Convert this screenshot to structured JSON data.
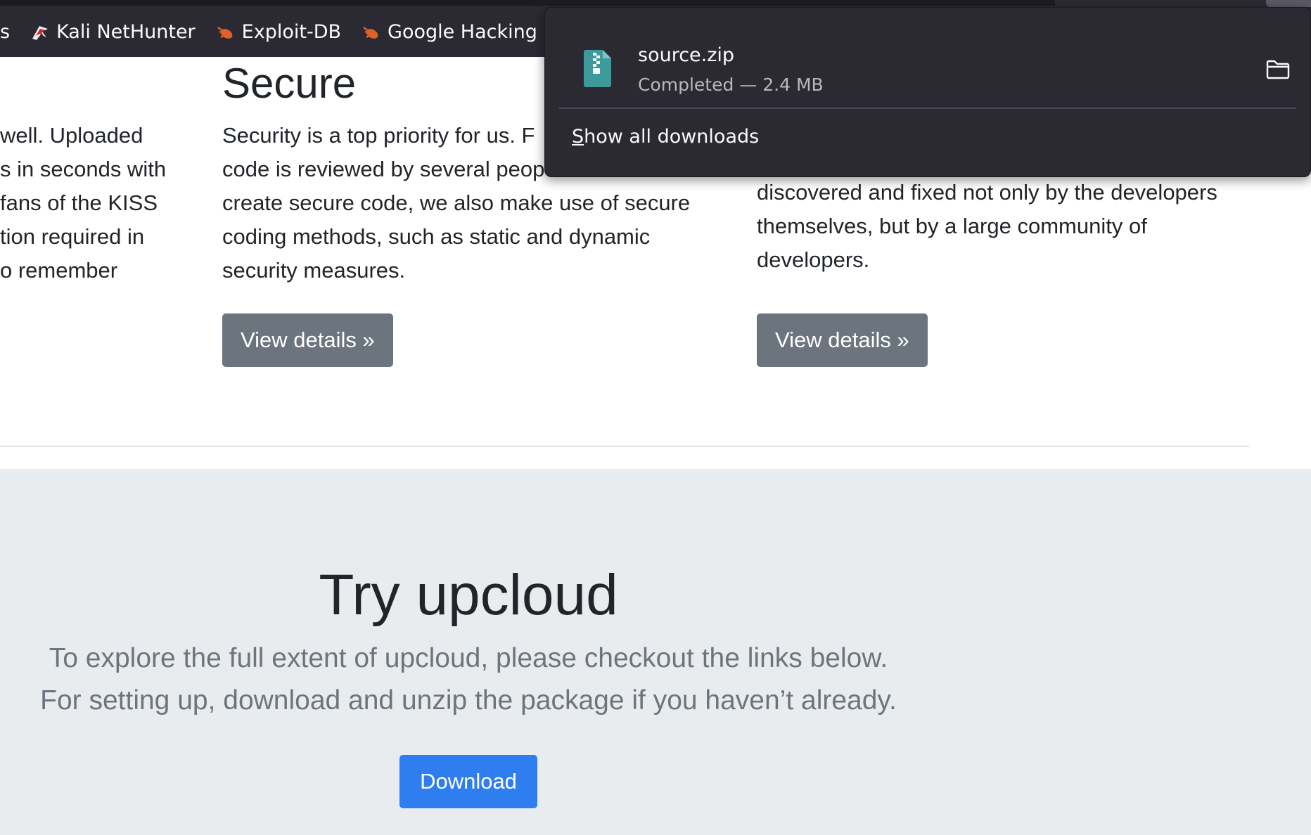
{
  "bookmarks": [
    {
      "label": "s",
      "icon": "none"
    },
    {
      "label": "Kali NetHunter",
      "icon": "kali-dragon-icon"
    },
    {
      "label": "Exploit-DB",
      "icon": "exploit-db-bug-icon"
    },
    {
      "label": "Google Hacking D",
      "icon": "exploit-db-bug-icon"
    }
  ],
  "columns": {
    "left": {
      "lines": [
        "well. Uploaded",
        "s in seconds with",
        "fans of the KISS",
        "tion required in",
        "o remember"
      ]
    },
    "middle": {
      "heading": "Secure",
      "lines": [
        "Security is a top priority for us. F",
        "code is reviewed by several peop",
        "create secure code, we also make use of secure",
        "coding methods, such as static and dynamic",
        "security measures."
      ],
      "button": "View details »"
    },
    "right": {
      "lines": [
        "discovered and fixed not only by the developers",
        "themselves, but by a large community of",
        "developers."
      ],
      "button": "View details »"
    }
  },
  "jumbotron": {
    "title": "Try upcloud",
    "lead_line1": "To explore the full extent of upcloud, please checkout the links below.",
    "lead_line2": "For setting up, download and unzip the package if you haven’t already.",
    "button": "Download"
  },
  "downloads_panel": {
    "filename": "source.zip",
    "status": "Completed — 2.4 MB",
    "show_all_access_key": "S",
    "show_all_rest": "how all downloads",
    "file_icon": "zip-file-icon",
    "folder_icon": "folder-icon"
  },
  "colors": {
    "chrome_bg": "#2b2a33",
    "primary": "#2e7ef0",
    "secondary": "#6c757d",
    "jumbotron_bg": "#e9ecef",
    "zip_icon": "#3d9a9b"
  }
}
